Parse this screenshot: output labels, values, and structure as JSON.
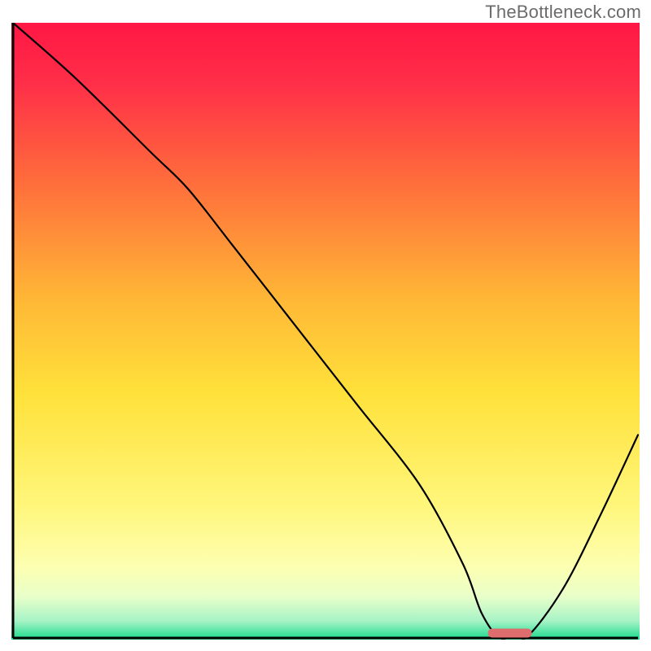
{
  "watermark": "TheBottleneck.com",
  "chart_data": {
    "type": "line",
    "title": "",
    "xlabel": "",
    "ylabel": "",
    "xlim": [
      0,
      100
    ],
    "ylim": [
      0,
      100
    ],
    "gradient_stops": [
      {
        "offset": 0.0,
        "color": "#ff1744"
      },
      {
        "offset": 0.1,
        "color": "#ff2f48"
      },
      {
        "offset": 0.25,
        "color": "#ff6a3c"
      },
      {
        "offset": 0.45,
        "color": "#ffb836"
      },
      {
        "offset": 0.6,
        "color": "#ffe13a"
      },
      {
        "offset": 0.78,
        "color": "#fff67a"
      },
      {
        "offset": 0.88,
        "color": "#fdffb0"
      },
      {
        "offset": 0.93,
        "color": "#e9ffc9"
      },
      {
        "offset": 0.97,
        "color": "#a6f3c6"
      },
      {
        "offset": 1.0,
        "color": "#17d98c"
      }
    ],
    "series": [
      {
        "name": "bottleneck-curve",
        "x": [
          0,
          10,
          22,
          28,
          35,
          45,
          55,
          65,
          72,
          75,
          78,
          82,
          88,
          94,
          100
        ],
        "y": [
          100,
          91,
          79,
          73,
          64,
          51,
          38,
          25,
          12,
          4,
          0,
          0,
          8,
          20,
          33
        ]
      }
    ],
    "marker": {
      "name": "optimal-range",
      "x_center": 79.5,
      "y": 0.8,
      "width": 7,
      "color": "#e06d6d"
    },
    "axis": {
      "stroke": "#000000",
      "width": 3
    }
  }
}
